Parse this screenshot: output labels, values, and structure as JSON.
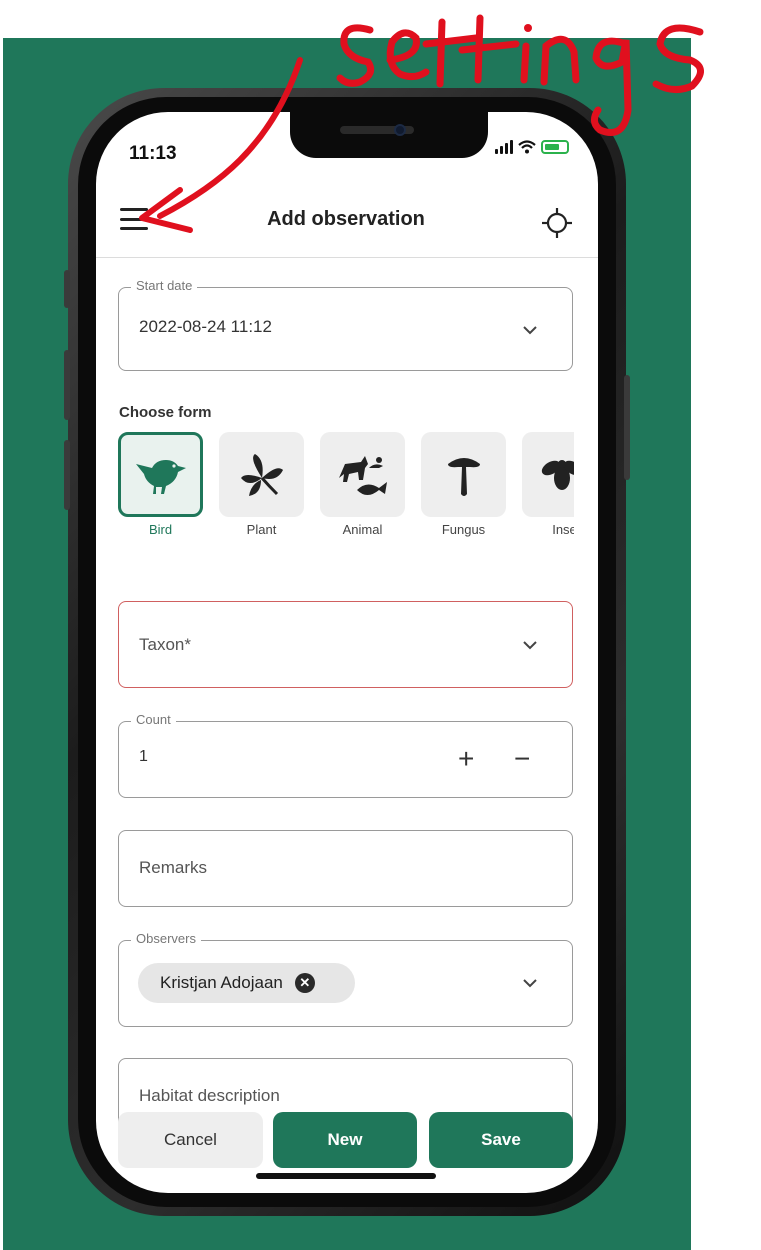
{
  "status_bar": {
    "time": "11:13"
  },
  "header": {
    "title": "Add observation",
    "menu_icon": "hamburger-menu-icon",
    "locate_icon": "crosshair-icon"
  },
  "start_date": {
    "label": "Start date",
    "value": "2022-08-24 11:12"
  },
  "choose_form": {
    "label": "Choose form",
    "options": [
      {
        "name": "Bird",
        "icon": "bird-icon",
        "selected": true
      },
      {
        "name": "Plant",
        "icon": "plant-icon",
        "selected": false
      },
      {
        "name": "Animal",
        "icon": "animal-icon",
        "selected": false
      },
      {
        "name": "Fungus",
        "icon": "mushroom-icon",
        "selected": false
      },
      {
        "name": "Inse",
        "icon": "insect-icon",
        "selected": false
      }
    ]
  },
  "taxon": {
    "placeholder": "Taxon*"
  },
  "count": {
    "label": "Count",
    "value": "1",
    "plus": "+",
    "minus": "−"
  },
  "remarks": {
    "placeholder": "Remarks"
  },
  "observers": {
    "label": "Observers",
    "chips": [
      "Kristjan Adojaan"
    ],
    "remove_symbol": "✕"
  },
  "habitat": {
    "placeholder": "Habitat description"
  },
  "actions": {
    "cancel": "Cancel",
    "new": "New",
    "save": "Save"
  },
  "annotation": {
    "text": "settings"
  },
  "colors": {
    "brand_green": "#1f775a",
    "error_red": "#d06060",
    "annotation_red": "#e0101e"
  }
}
